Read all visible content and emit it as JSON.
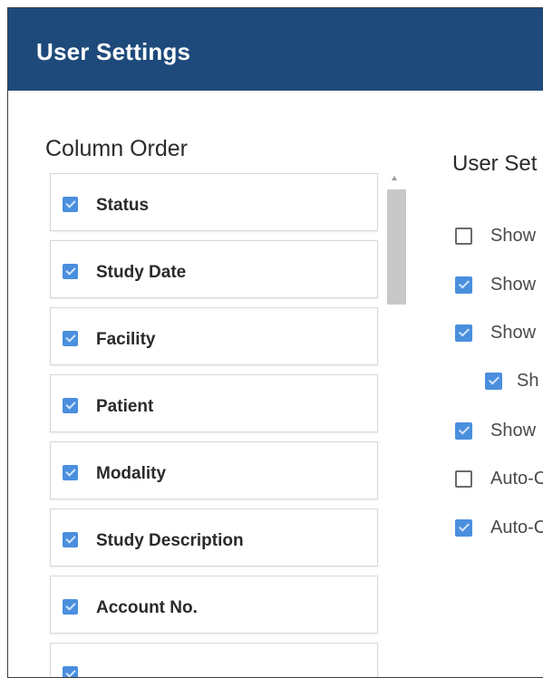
{
  "header": {
    "title": "User Settings"
  },
  "column_order": {
    "title": "Column Order",
    "items": [
      {
        "label": "Status",
        "checked": true
      },
      {
        "label": "Study Date",
        "checked": true
      },
      {
        "label": "Facility",
        "checked": true
      },
      {
        "label": "Patient",
        "checked": true
      },
      {
        "label": "Modality",
        "checked": true
      },
      {
        "label": "Study Description",
        "checked": true
      },
      {
        "label": "Account No.",
        "checked": true
      },
      {
        "label": "",
        "checked": true
      }
    ]
  },
  "user_settings": {
    "title": "User Set",
    "options": [
      {
        "label": "Show",
        "checked": false
      },
      {
        "label": "Show",
        "checked": true
      },
      {
        "label": "Show",
        "checked": true
      },
      {
        "label": "Sh",
        "checked": true
      },
      {
        "label": "Show",
        "checked": true
      },
      {
        "label": "Auto-C",
        "checked": false
      },
      {
        "label": "Auto-C",
        "checked": true
      }
    ]
  },
  "colors": {
    "header": "#1e4a7b",
    "checkbox": "#4a8fde"
  }
}
